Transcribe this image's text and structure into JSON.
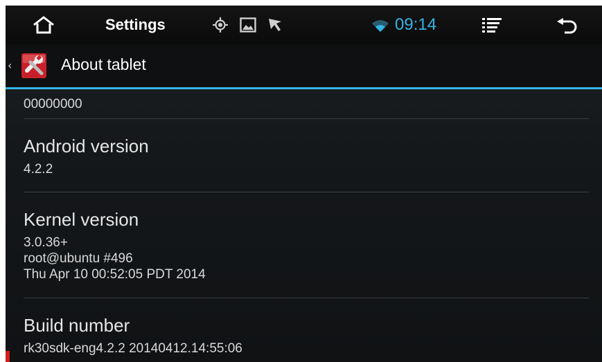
{
  "status_bar": {
    "home_icon": "home-icon",
    "title": "Settings",
    "notification_icons": [
      "gps-icon",
      "gallery-icon",
      "cursor-icon"
    ],
    "wifi_icon": "wifi-icon",
    "time": "09:14",
    "menu_icon": "menu-icon",
    "back_icon": "back-icon",
    "accent_color": "#33b5e5"
  },
  "action_bar": {
    "up_caret": "‹",
    "app_icon": "settings-wrench-icon",
    "title": "About tablet",
    "underline_color": "#33b5e5"
  },
  "list": {
    "partial_value": "00000000",
    "items": [
      {
        "title": "Android version",
        "summary": [
          "4.2.2"
        ]
      },
      {
        "title": "Kernel version",
        "summary": [
          "3.0.36+",
          "root@ubuntu #496",
          "Thu Apr 10 00:52:05 PDT 2014"
        ]
      },
      {
        "title": "Build number",
        "summary": [
          "rk30sdk-eng4.2.2 20140412.14:55:06"
        ]
      }
    ]
  }
}
